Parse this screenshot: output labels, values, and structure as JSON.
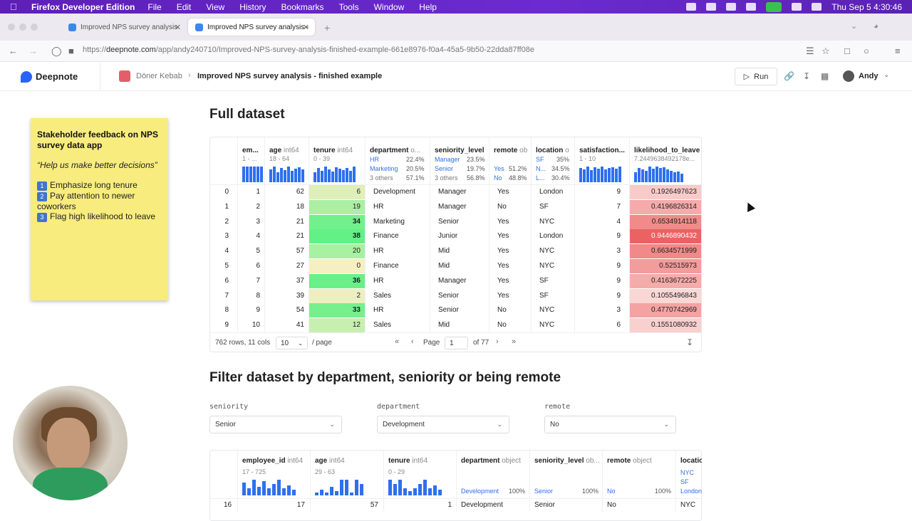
{
  "menubar": {
    "app": "Firefox Developer Edition",
    "items": [
      "File",
      "Edit",
      "View",
      "History",
      "Bookmarks",
      "Tools",
      "Window",
      "Help"
    ],
    "clock": "Thu Sep 5  4:30:46"
  },
  "browser": {
    "tabs": [
      {
        "title": "Improved NPS survey analysis"
      },
      {
        "title": "Improved NPS survey analysis -"
      }
    ],
    "url_prefix": "https://",
    "url_domain": "deepnote.com",
    "url_path": "/app/andy240710/Improved-NPS-survey-analysis-finished-example-661e8976-f0a4-45a5-9b50-22dda87ff08e"
  },
  "header": {
    "logo": "Deepnote",
    "crumb_workspace": "Döner Kebab",
    "crumb_notebook": "Improved NPS survey analysis - finished example",
    "run_label": "Run",
    "user": "Andy"
  },
  "sticky": {
    "title": "Stakeholder feedback on NPS survey data app",
    "quote": "“Help us make better decisions”",
    "items": [
      {
        "num": "1",
        "text": "Emphasize long tenure"
      },
      {
        "num": "2",
        "text": "Pay attention to newer coworkers"
      },
      {
        "num": "3",
        "text": "Flag high likelihood to leave"
      }
    ]
  },
  "section1": {
    "title": "Full dataset"
  },
  "table1": {
    "columns": [
      {
        "name": "em...",
        "type": "",
        "summary": "1 - ..."
      },
      {
        "name": "age",
        "type": "int64",
        "summary": "18 - 64"
      },
      {
        "name": "tenure",
        "type": "int64",
        "summary": "0 - 39"
      },
      {
        "name": "department",
        "type": "o...",
        "summary": ""
      },
      {
        "name": "seniority_level",
        "type": "",
        "summary": ""
      },
      {
        "name": "remote",
        "type": "ob",
        "summary": ""
      },
      {
        "name": "location",
        "type": "o",
        "summary": ""
      },
      {
        "name": "satisfaction...",
        "type": "",
        "summary": "1 - 10"
      },
      {
        "name": "likelihood_to_leave",
        "type": "",
        "summary": "7.2449638492178e..."
      }
    ],
    "dept_cats": [
      [
        "HR",
        "22.4%"
      ],
      [
        "Marketing",
        "20.5%"
      ],
      [
        "3 others",
        "57.1%"
      ]
    ],
    "sen_cats": [
      [
        "Manager",
        "23.5%"
      ],
      [
        "Senior",
        "19.7%"
      ],
      [
        "3 others",
        "56.8%"
      ]
    ],
    "remote_cats": [
      [
        "Yes",
        "51.2%"
      ],
      [
        "No",
        "48.8%"
      ]
    ],
    "loc_cats": [
      [
        "SF",
        "35%"
      ],
      [
        "N...",
        "34.5%"
      ],
      [
        "L...",
        "30.4%"
      ]
    ],
    "rows": [
      {
        "idx": "0",
        "emp": "1",
        "age": "62",
        "tenure": "6",
        "dept": "Development",
        "sen": "Manager",
        "remote": "Yes",
        "loc": "London",
        "sat": "9",
        "leave": "0.1926497623",
        "tenure_frac": 0.15,
        "leave_val": 0.1926497623
      },
      {
        "idx": "1",
        "emp": "2",
        "age": "18",
        "tenure": "19",
        "dept": "HR",
        "sen": "Manager",
        "remote": "No",
        "loc": "SF",
        "sat": "7",
        "leave": "0.4196826314",
        "tenure_frac": 0.49,
        "leave_val": 0.4196826314
      },
      {
        "idx": "2",
        "emp": "3",
        "age": "21",
        "tenure": "34",
        "dept": "Marketing",
        "sen": "Senior",
        "remote": "Yes",
        "loc": "NYC",
        "sat": "4",
        "leave": "0.6534914118",
        "tenure_frac": 0.87,
        "leave_val": 0.6534914118
      },
      {
        "idx": "3",
        "emp": "4",
        "age": "21",
        "tenure": "38",
        "dept": "Finance",
        "sen": "Junior",
        "remote": "Yes",
        "loc": "London",
        "sat": "9",
        "leave": "0.9446890432",
        "tenure_frac": 0.97,
        "leave_val": 0.9446890432
      },
      {
        "idx": "4",
        "emp": "5",
        "age": "57",
        "tenure": "20",
        "dept": "HR",
        "sen": "Mid",
        "remote": "Yes",
        "loc": "NYC",
        "sat": "3",
        "leave": "0.6634571999",
        "tenure_frac": 0.51,
        "leave_val": 0.6634571999
      },
      {
        "idx": "5",
        "emp": "6",
        "age": "27",
        "tenure": "0",
        "dept": "Finance",
        "sen": "Mid",
        "remote": "Yes",
        "loc": "NYC",
        "sat": "9",
        "leave": "0.52515973",
        "tenure_frac": 0.0,
        "leave_val": 0.52515973
      },
      {
        "idx": "6",
        "emp": "7",
        "age": "37",
        "tenure": "36",
        "dept": "HR",
        "sen": "Manager",
        "remote": "Yes",
        "loc": "SF",
        "sat": "9",
        "leave": "0.4163672225",
        "tenure_frac": 0.92,
        "leave_val": 0.4163672225
      },
      {
        "idx": "7",
        "emp": "8",
        "age": "39",
        "tenure": "2",
        "dept": "Sales",
        "sen": "Senior",
        "remote": "Yes",
        "loc": "SF",
        "sat": "9",
        "leave": "0.1055496843",
        "tenure_frac": 0.05,
        "leave_val": 0.1055496843
      },
      {
        "idx": "8",
        "emp": "9",
        "age": "54",
        "tenure": "33",
        "dept": "HR",
        "sen": "Senior",
        "remote": "No",
        "loc": "NYC",
        "sat": "3",
        "leave": "0.4770742969",
        "tenure_frac": 0.85,
        "leave_val": 0.4770742969
      },
      {
        "idx": "9",
        "emp": "10",
        "age": "41",
        "tenure": "12",
        "dept": "Sales",
        "sen": "Mid",
        "remote": "No",
        "loc": "NYC",
        "sat": "6",
        "leave": "0.1551080932",
        "tenure_frac": 0.31,
        "leave_val": 0.1551080932
      }
    ],
    "footer": {
      "summary": "762 rows, 11 cols",
      "page_size": "10",
      "per_page": "/ page",
      "page_label": "Page",
      "page_value": "1",
      "of_pages": "of 77"
    }
  },
  "section2": {
    "title": "Filter dataset by department, seniority or being remote"
  },
  "filters": [
    {
      "label": "seniority",
      "value": "Senior"
    },
    {
      "label": "department",
      "value": "Development"
    },
    {
      "label": "remote",
      "value": "No"
    }
  ],
  "table2": {
    "columns": [
      {
        "name": "employee_id",
        "type": "int64",
        "summary": "17 - 725"
      },
      {
        "name": "age",
        "type": "int64",
        "summary": "29 - 63"
      },
      {
        "name": "tenure",
        "type": "int64",
        "summary": "0 - 29"
      },
      {
        "name": "department",
        "type": "object",
        "cat": "Development",
        "pct": "100%"
      },
      {
        "name": "seniority_level",
        "type": "ob...",
        "cat": "Senior",
        "pct": "100%"
      },
      {
        "name": "remote",
        "type": "object",
        "cat": "No",
        "pct": "100%"
      },
      {
        "name": "locatio",
        "type": "",
        "cats": [
          "NYC",
          "SF",
          "London"
        ]
      }
    ],
    "rows": [
      {
        "idx": "16",
        "emp": "17",
        "age": "57",
        "tenure": "1",
        "dept": "Development",
        "sen": "Senior",
        "remote": "No",
        "loc": "NYC"
      }
    ]
  },
  "colors": {
    "accent": "#2f6ff0",
    "menubar": "#6b2bd0",
    "tenure_high": "#5ef082",
    "tenure_low": "#f6efc4",
    "leave_high": "#ea5a5a",
    "leave_low": "#fbe6e3",
    "sticky": "#f8ec7e"
  }
}
